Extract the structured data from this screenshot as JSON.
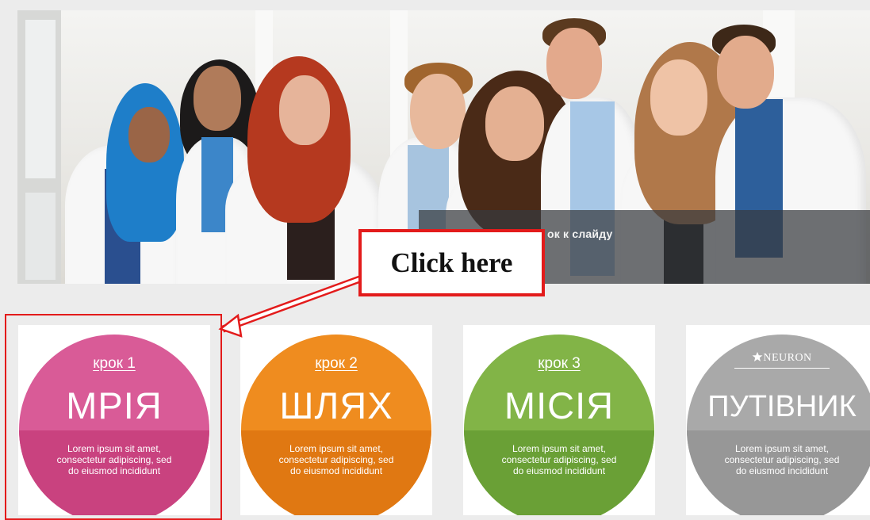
{
  "hero": {
    "slide_link_text": "ок к слайду"
  },
  "callout": {
    "text": "Click here"
  },
  "cards": [
    {
      "step": "крок 1",
      "title": "МРІЯ",
      "text": "Lorem ipsum sit amet, consectetur adipiscing, sed do eiusmod incididunt",
      "color_top": "#d95b97",
      "color_bottom": "#c9427f"
    },
    {
      "step": "крок 2",
      "title": "ШЛЯХ",
      "text": "Lorem ipsum sit amet, consectetur adipiscing, sed do eiusmod incididunt",
      "color_top": "#ef8c1f",
      "color_bottom": "#e07812"
    },
    {
      "step": "крок 3",
      "title": "МІСІЯ",
      "text": "Lorem ipsum sit amet, consectetur adipiscing, sed do eiusmod incididunt",
      "color_top": "#82b447",
      "color_bottom": "#6aa036"
    },
    {
      "logo": "NEURON",
      "title": "ПУТІВНИК",
      "text": "Lorem ipsum sit amet, consectetur adipiscing, sed do eiusmod incididunt",
      "color_top": "#a9a9a9",
      "color_bottom": "#979797"
    }
  ],
  "colors": {
    "highlight": "#e31b1b",
    "background": "#ececec"
  }
}
